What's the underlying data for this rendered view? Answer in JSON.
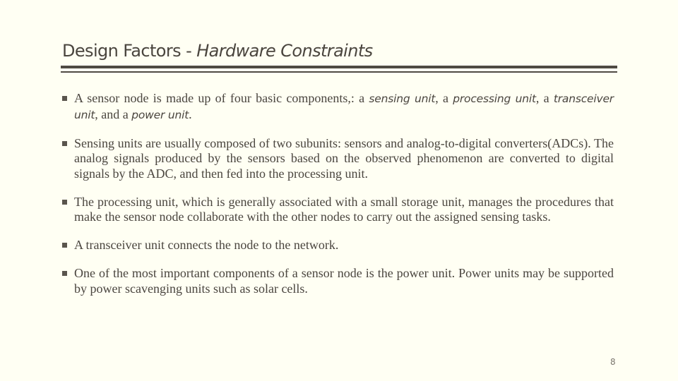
{
  "slide": {
    "title_main": "Design Factors - ",
    "title_italic": "Hardware Constraints",
    "page_number": "8"
  },
  "bullets": [
    {
      "segments": [
        {
          "text": "A sensor node is made up of four basic components,: a ",
          "italic": false
        },
        {
          "text": "sensing unit",
          "italic": true
        },
        {
          "text": ", a ",
          "italic": false
        },
        {
          "text": "processing unit",
          "italic": true
        },
        {
          "text": ", a ",
          "italic": false
        },
        {
          "text": "transceiver unit",
          "italic": true
        },
        {
          "text": ", and a ",
          "italic": false
        },
        {
          "text": "power unit",
          "italic": true
        },
        {
          "text": ".",
          "italic": false
        }
      ]
    },
    {
      "segments": [
        {
          "text": "Sensing units are usually composed of two subunits: sensors and analog-to-digital converters(ADCs). The analog signals produced by the sensors based on the observed phenomenon are converted to digital signals by the ADC, and then fed into the processing unit.",
          "italic": false
        }
      ]
    },
    {
      "segments": [
        {
          "text": "The processing unit, which is generally associated with a small storage unit, manages the procedures that make the sensor node collaborate with the other nodes to carry out the assigned sensing tasks.",
          "italic": false
        }
      ]
    },
    {
      "segments": [
        {
          "text": "A transceiver unit connects the node to the network.",
          "italic": false
        }
      ]
    },
    {
      "segments": [
        {
          "text": "One of the most important components of a sensor node is the power unit. Power units may be supported by power scavenging units such as solar cells.",
          "italic": false
        }
      ]
    }
  ],
  "icons": {
    "bullet": "square-bullet-icon"
  }
}
